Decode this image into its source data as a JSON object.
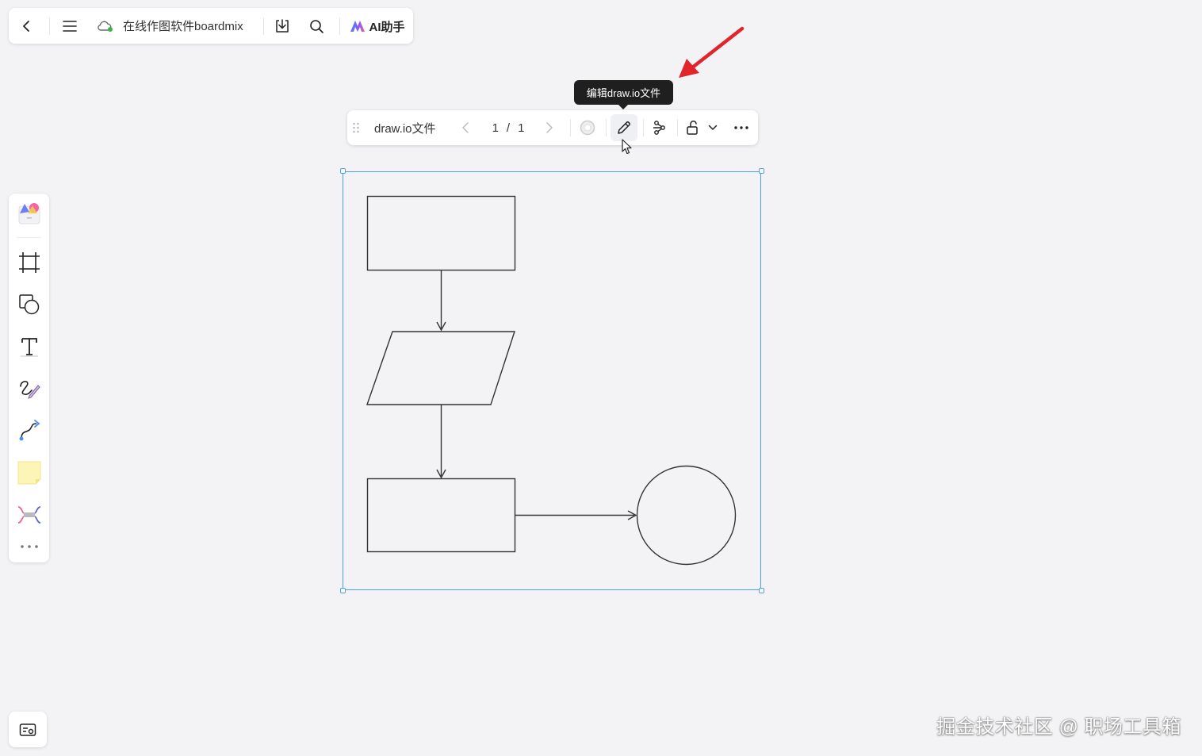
{
  "topbar": {
    "doc_title": "在线作图软件boardmix",
    "ai_label": "AI助手"
  },
  "tooltip": {
    "text": "编辑draw.io文件"
  },
  "object_toolbar": {
    "file_name": "draw.io文件",
    "page_current": "1",
    "page_sep": "/",
    "page_total": "1"
  },
  "left_tools": [
    {
      "icon": "template-icon"
    },
    {
      "icon": "frame-icon"
    },
    {
      "icon": "shape-icon"
    },
    {
      "icon": "text-icon"
    },
    {
      "icon": "pen-icon"
    },
    {
      "icon": "connector-icon"
    },
    {
      "icon": "sticky-note-icon"
    },
    {
      "icon": "mindmap-icon"
    },
    {
      "icon": "more-icon"
    }
  ],
  "watermark": "掘金技术社区 @ 职场工具箱",
  "colors": {
    "selection": "#4a9ff5",
    "annotation_arrow": "#e0262b",
    "cloud_sync": "#3bb54a"
  }
}
